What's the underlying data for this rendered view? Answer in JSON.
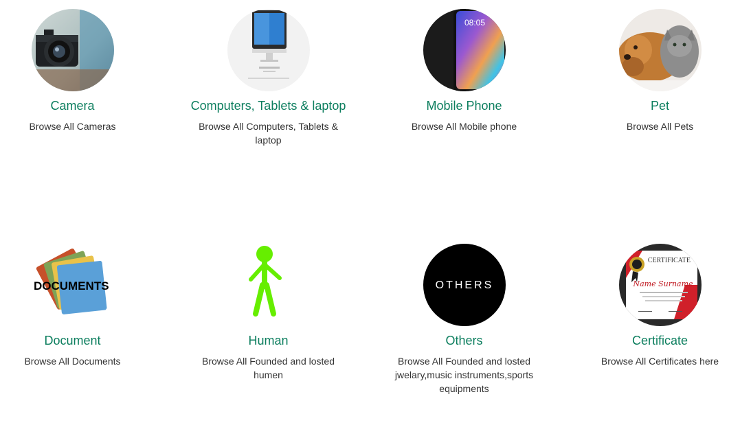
{
  "colors": {
    "title": "#0c7e5e",
    "description": "#333333",
    "background": "#ffffff"
  },
  "categories": [
    {
      "icon": "camera-image",
      "title": "Camera",
      "description": "Browse All Cameras"
    },
    {
      "icon": "computer-image",
      "title": "Computers, Tablets & laptop",
      "description": "Browse All Computers, Tablets & laptop"
    },
    {
      "icon": "mobile-phone-image",
      "title": "Mobile Phone",
      "description": "Browse All Mobile phone"
    },
    {
      "icon": "pet-image",
      "title": "Pet",
      "description": "Browse All Pets"
    },
    {
      "icon": "documents-image",
      "title": "Document",
      "description": "Browse All Documents",
      "image_text": "DOCUMENTS"
    },
    {
      "icon": "human-stick-figure-image",
      "title": "Human",
      "description": "Browse All Founded and losted humen"
    },
    {
      "icon": "others-image",
      "title": "Others",
      "description": "Browse All Founded and losted jwelary,music instruments,sports equipments",
      "image_text": "OTHERS"
    },
    {
      "icon": "certificate-image",
      "title": "Certificate",
      "description": "Browse All Certificates here",
      "image_text": "CERTIFICATE",
      "image_subtext": "Name Surname"
    }
  ],
  "phone_screen_time": "08:05"
}
